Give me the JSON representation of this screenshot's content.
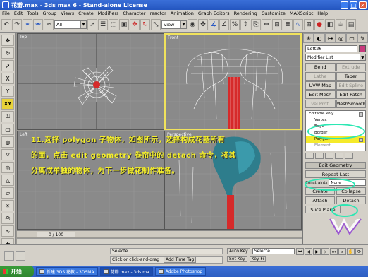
{
  "window": {
    "title": "花瓣.max - 3ds max 6 - Stand-alone License"
  },
  "menu": [
    "File",
    "Edit",
    "Tools",
    "Group",
    "Views",
    "Create",
    "Modifiers",
    "Character",
    "reactor",
    "Animation",
    "Graph Editors",
    "Rendering",
    "Customize",
    "MAXScript",
    "Help"
  ],
  "toolbar": {
    "filter_select": "All",
    "view_select": "View"
  },
  "viewports": {
    "top": "Top",
    "front": "Front",
    "left": "Left",
    "perspective": "Perspective"
  },
  "left_tools": {
    "xy_label": "XY"
  },
  "panel": {
    "object_name": "Loft26",
    "modifier_list": "Modifier List",
    "mod_buttons": [
      {
        "label": "Bend",
        "dim": false
      },
      {
        "label": "Extrude",
        "dim": true
      },
      {
        "label": "Lathe",
        "dim": true
      },
      {
        "label": "Taper",
        "dim": false
      },
      {
        "label": "UVW Map",
        "dim": false
      },
      {
        "label": "Edit Spline",
        "dim": true
      },
      {
        "label": "Edit Mesh",
        "dim": false
      },
      {
        "label": "Edit Patch",
        "dim": false
      },
      {
        "label": "vel Profi",
        "dim": true
      },
      {
        "label": "MeshSmooth",
        "dim": false
      }
    ],
    "stack": [
      {
        "label": "Editable Poly",
        "sub": false,
        "sel": false
      },
      {
        "label": "Vertex",
        "sub": true,
        "sel": false
      },
      {
        "label": "Edge",
        "sub": true,
        "sel": false
      },
      {
        "label": "Border",
        "sub": true,
        "sel": false
      },
      {
        "label": "Polygon",
        "sub": true,
        "sel": true
      },
      {
        "label": "Element",
        "sub": true,
        "sel": false
      }
    ],
    "edit_geometry_title": "Edit Geometry",
    "repeat_last": "Repeat Last",
    "constraints_label": "Constraints",
    "constraints_value": "None",
    "create": "Create",
    "collapse": "Collapse",
    "attach": "Attach",
    "detach": "Detach",
    "slice_plane": "Slice Plane"
  },
  "annotation": {
    "line1": "11.选择 polygon 子物体，如图所示，选择构成花茎所有",
    "line2": "的面，点击 edit geometry 卷帘中的 detach 命令，将其",
    "line3": "分离成单独的物体，为下一步做花制作准备。"
  },
  "timeline": {
    "frame": "0 / 100"
  },
  "status": {
    "prompt": "Selecte",
    "hint": "Click or click-and-drag",
    "add_time_tag": "Add Time Tag",
    "set_key": "Set Key",
    "key_filters": "Key Fi",
    "auto_key": "Auto Key",
    "key_mode": "Selecte"
  },
  "taskbar": {
    "start": "开始",
    "tasks": [
      "新建 3DS 花教 - 3DSMA",
      "花瓣.max - 3ds ma",
      "Adobe Photoshop"
    ]
  }
}
